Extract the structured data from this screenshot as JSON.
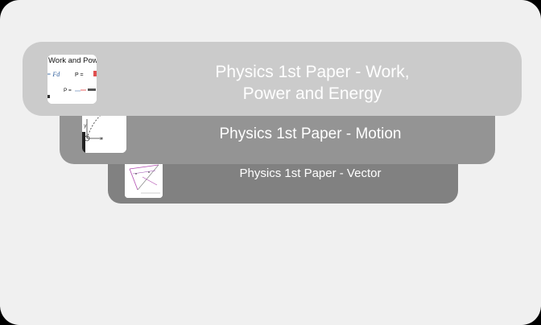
{
  "cards": [
    {
      "id": "work",
      "title_line1": "Physics 1st Paper - Work,",
      "title_line2": "Power and Energy",
      "thumb_heading": "Work and Pow",
      "thumb_formula_left": "= Fd",
      "thumb_formula_right": "P =",
      "thumb_formula_bottom": "P ="
    },
    {
      "id": "motion",
      "title": "Physics 1st Paper - Motion",
      "thumb_axis_y": "y",
      "thumb_axis_x": "x"
    },
    {
      "id": "vector",
      "title": "Physics 1st Paper - Vector"
    }
  ],
  "colors": {
    "background": "#f0f0f0",
    "card_front": "#cbcbcb",
    "card_middle": "#949494",
    "card_back": "#818181",
    "text": "#ffffff"
  }
}
